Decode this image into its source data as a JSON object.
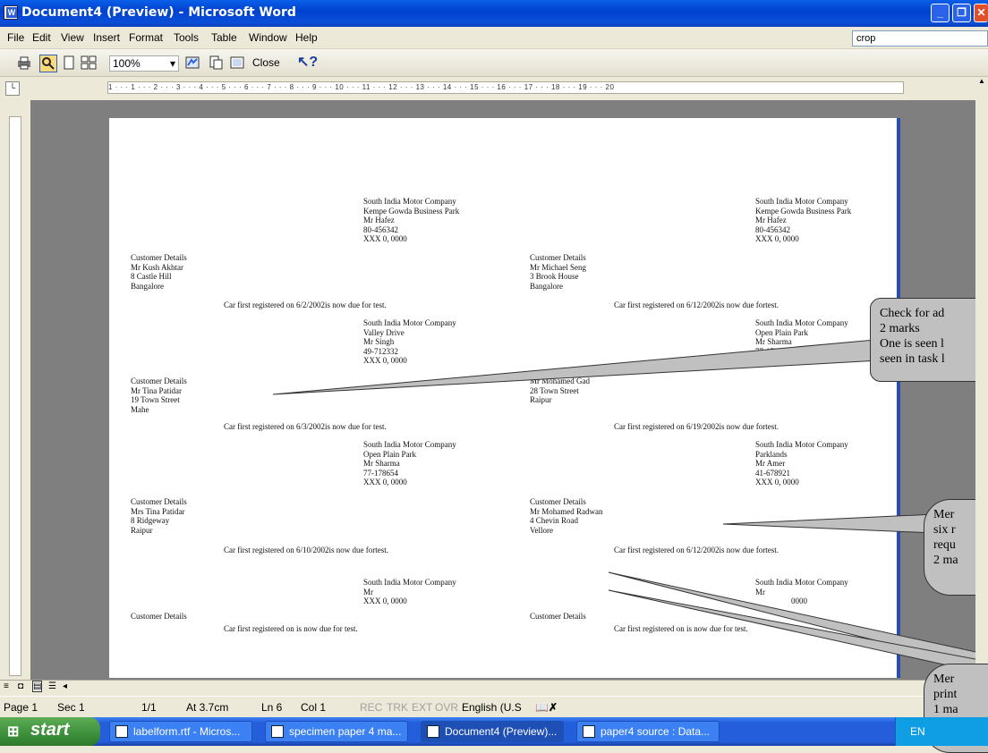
{
  "window": {
    "title": "Document4 (Preview) - Microsoft Word"
  },
  "menu": {
    "items": [
      "File",
      "Edit",
      "View",
      "Insert",
      "Format",
      "Tools",
      "Table",
      "Window",
      "Help"
    ],
    "help_box": "crop"
  },
  "toolbar": {
    "zoom": "100%",
    "close_label": "Close"
  },
  "ruler": {
    "h_text": "1 · · · 1 · · · 2 · · · 3 · · · 4 · · · 5 · · · 6 · · · 7 · · · 8 · · · 9 · · · 10 · · · 11 · · · 12 · · · 13 · · · 14 · · · 15 · · · 16 · · · 17 · · · 18 · · · 19 · · · 20"
  },
  "labels": [
    {
      "header": [
        "South India Motor Company",
        "Kempe Gowda Business Park",
        "Mr Hafez",
        "80-456342",
        "XXX 0, 0000"
      ],
      "customer": [
        "Customer Details",
        "Mr Kush Akhtar",
        "8 Castle Hill",
        "Bangalore"
      ],
      "footer": "Car first registered on 6/2/2002is now due for test."
    },
    {
      "header": [
        "South India Motor Company",
        "Kempe Gowda Business Park",
        "Mr Hafez",
        "80-456342",
        "XXX 0, 0000"
      ],
      "customer": [
        "Customer Details",
        "Mr Michael Seng",
        "3 Brook House",
        "Bangalore"
      ],
      "footer": "Car first registered on 6/12/2002is now due fortest."
    },
    {
      "header": [
        "South India Motor Company",
        "Valley Drive",
        "Mr Singh",
        "49-712332",
        "XXX 0, 0000"
      ],
      "customer": [
        "Customer Details",
        "Mr Tina Patidar",
        "19 Town Street",
        "Mahe"
      ],
      "footer": "Car first registered on 6/3/2002is now due for test."
    },
    {
      "header": [
        "South India Motor Company",
        "Open Plain Park",
        "Mr Sharma",
        "77-178654",
        ""
      ],
      "customer": [
        "",
        "Mr Mohamed Gad",
        "28 Town Street",
        "Raipur"
      ],
      "footer": "Car first registered on 6/19/2002is now due fortest."
    },
    {
      "header": [
        "South India Motor Company",
        "Open Plain Park",
        "Mr Sharma",
        "77-178654",
        "XXX 0, 0000"
      ],
      "customer": [
        "Customer Details",
        "Mrs Tina Patidar",
        "8 Ridgeway",
        "Raipur"
      ],
      "footer": "Car first registered on 6/10/2002is now due fortest."
    },
    {
      "header": [
        "South India Motor Company",
        "Parklands",
        "Mr Amer",
        "41-678921",
        "XXX 0, 0000"
      ],
      "customer": [
        "Customer Details",
        "Mr Mohamed Radwan",
        "4 Chevin Road",
        "Vellore"
      ],
      "footer": "Car first registered on 6/12/2002is now due fortest."
    },
    {
      "header": [
        "South India Motor Company",
        "Mr",
        "XXX 0, 0000"
      ],
      "customer": [
        "Customer Details"
      ],
      "footer": "Car first registered on is now due for test."
    },
    {
      "header": [
        "South India Motor Company",
        "Mr",
        "0000"
      ],
      "customer": [
        "Customer Details"
      ],
      "footer": "Car first registered on is now due for test."
    }
  ],
  "callouts": [
    {
      "lines": [
        "Check for ad",
        "2 marks",
        "One is seen l",
        "seen in task l"
      ]
    },
    {
      "lines": [
        "Mer",
        "six r",
        "requ",
        "2 ma"
      ]
    },
    {
      "lines": [
        "Mer",
        "print",
        "1 ma"
      ]
    }
  ],
  "status": {
    "page": "Page 1",
    "sec": "Sec 1",
    "pages": "1/1",
    "at": "At 3.7cm",
    "ln": "Ln 6",
    "col": "Col 1",
    "rec": "REC",
    "trk": "TRK",
    "ext": "EXT",
    "ovr": "OVR",
    "lang": "English (U.S"
  },
  "taskbar": {
    "start": "start",
    "tasks": [
      "labelform.rtf - Micros...",
      "specimen paper 4 ma...",
      "Document4 (Preview)...",
      "paper4 source : Data..."
    ],
    "tray": "EN"
  },
  "colors": {
    "title_bar": "#0042d0",
    "callout_fill": "#c0c0c0",
    "doc_background": "#7f7f7f"
  }
}
